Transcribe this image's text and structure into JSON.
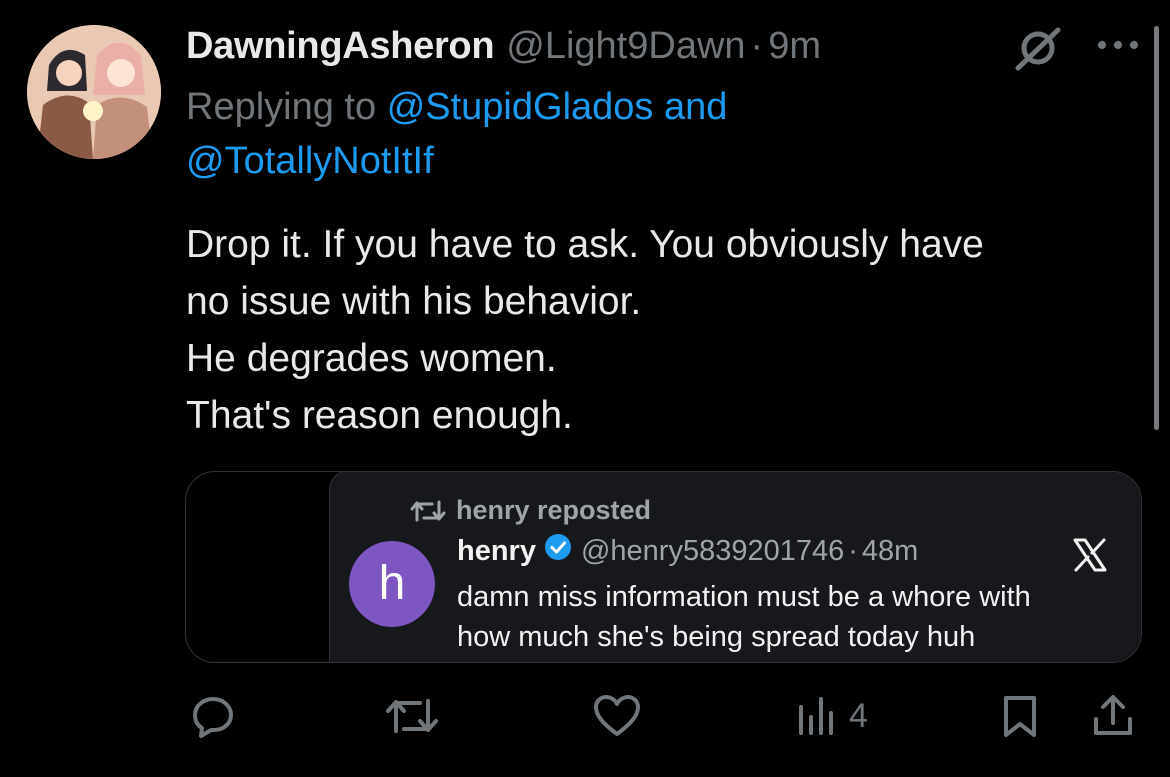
{
  "tweet": {
    "display_name": "DawningAsheron",
    "handle": "@Light9Dawn",
    "separator": "·",
    "time": "9m",
    "replying_prefix": "Replying to",
    "reply_mention_1": "@StupidGlados",
    "reply_and": "and",
    "reply_mention_2": "@TotallyNotItIf",
    "body_lines": [
      "Drop it. If you have to ask. You obviously have",
      "no issue with his behavior.",
      "He degrades women.",
      "That's reason enough."
    ]
  },
  "quoted": {
    "repost_text": "henry reposted",
    "avatar_letter": "h",
    "name": "henry",
    "handle": "@henry5839201746",
    "separator": "·",
    "time": "48m",
    "text_lines": [
      "damn miss information must be a whore with",
      "how much she's being spread today huh"
    ]
  },
  "actions": {
    "views_count": "4"
  },
  "icons": {
    "grok": "grok-icon",
    "more": "more-icon",
    "reply": "reply-icon",
    "repost": "repost-icon",
    "like": "like-icon",
    "views": "views-icon",
    "bookmark": "bookmark-icon",
    "share": "share-icon",
    "verified": "verified-badge-icon",
    "x_logo": "x-logo-icon"
  },
  "colors": {
    "background": "#000000",
    "text": "#e7e9ea",
    "muted": "#71767b",
    "link": "#1d9bf0",
    "verified": "#1d9bf0",
    "avatar_h": "#7e56c2"
  }
}
